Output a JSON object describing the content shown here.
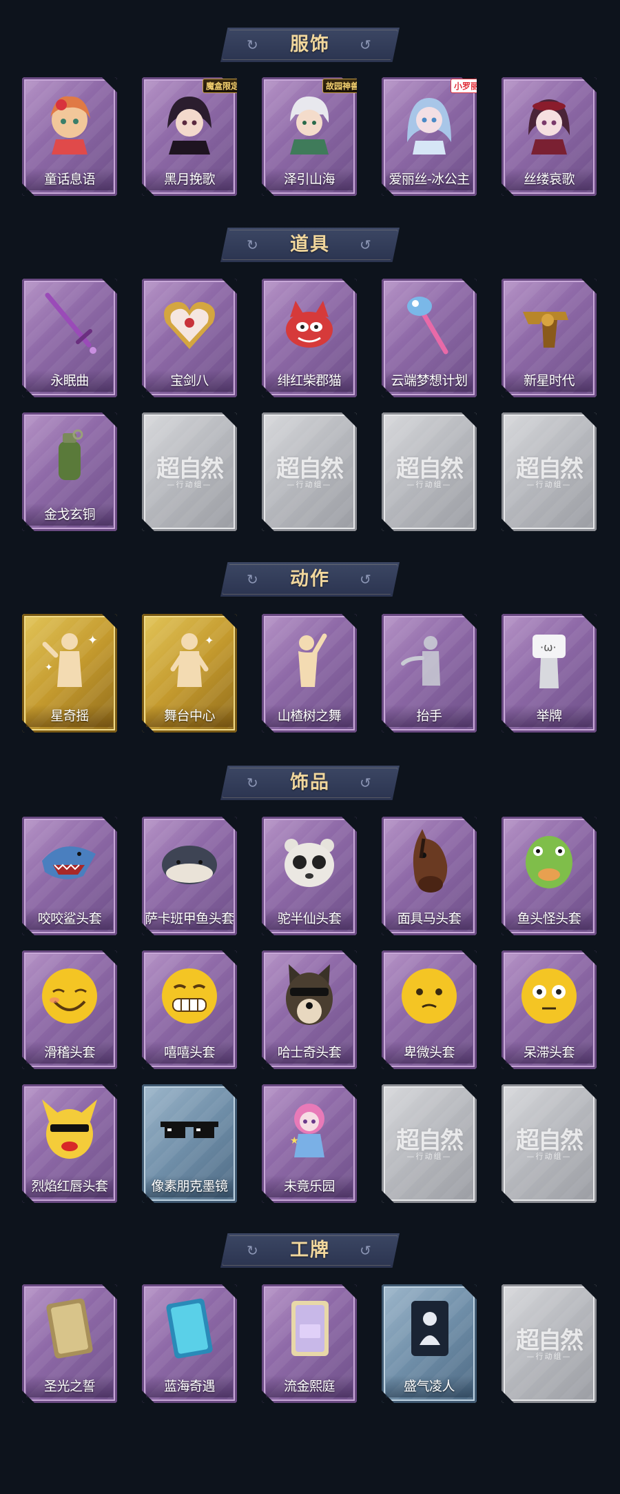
{
  "sections": [
    {
      "title": "服饰",
      "items": [
        {
          "label": "童话息语",
          "frame": "purple",
          "icon": "fairy-girl-costume"
        },
        {
          "label": "黑月挽歌",
          "frame": "purple",
          "icon": "dark-moon-girl-costume",
          "tag": "魔盒限定",
          "tag_style": "gold"
        },
        {
          "label": "泽引山海",
          "frame": "purple",
          "icon": "mountain-sea-boy-costume",
          "tag": "故园神兽",
          "tag_style": "gold"
        },
        {
          "label": "爱丽丝-冰公主",
          "frame": "purple",
          "icon": "ice-princess-costume",
          "tag": "小罗丽",
          "tag_style": "red"
        },
        {
          "label": "丝缕哀歌",
          "frame": "purple",
          "icon": "silk-elegy-girl-costume"
        }
      ]
    },
    {
      "title": "道具",
      "items": [
        {
          "label": "永眠曲",
          "frame": "purple",
          "icon": "sword-icon"
        },
        {
          "label": "宝剑八",
          "frame": "purple",
          "icon": "heart-mirror-icon"
        },
        {
          "label": "绯红柴郡猫",
          "frame": "purple",
          "icon": "red-cat-icon"
        },
        {
          "label": "云端梦想计划",
          "frame": "purple",
          "icon": "dream-wand-icon"
        },
        {
          "label": "新星时代",
          "frame": "purple",
          "icon": "revolver-icon"
        },
        {
          "label": "金戈玄铜",
          "frame": "purple",
          "icon": "grenade-icon"
        },
        {
          "label": "",
          "frame": "gray",
          "placeholder": true
        },
        {
          "label": "",
          "frame": "gray",
          "placeholder": true
        },
        {
          "label": "",
          "frame": "gray",
          "placeholder": true
        },
        {
          "label": "",
          "frame": "gray",
          "placeholder": true
        }
      ]
    },
    {
      "title": "动作",
      "items": [
        {
          "label": "星奇摇",
          "frame": "gold",
          "icon": "sparkle-dance-icon"
        },
        {
          "label": "舞台中心",
          "frame": "gold",
          "icon": "stage-center-icon"
        },
        {
          "label": "山楂树之舞",
          "frame": "purple",
          "icon": "hawthorn-dance-icon"
        },
        {
          "label": "抬手",
          "frame": "purple",
          "icon": "raise-hand-icon"
        },
        {
          "label": "举牌",
          "frame": "purple",
          "icon": "hold-sign-icon"
        }
      ]
    },
    {
      "title": "饰品",
      "items": [
        {
          "label": "咬咬鲨头套",
          "frame": "purple",
          "icon": "shark-head-icon"
        },
        {
          "label": "萨卡班甲鱼头套",
          "frame": "purple",
          "icon": "fish-head-icon"
        },
        {
          "label": "驼半仙头套",
          "frame": "purple",
          "icon": "bear-sunglasses-icon"
        },
        {
          "label": "面具马头套",
          "frame": "purple",
          "icon": "horse-mask-icon"
        },
        {
          "label": "鱼头怪头套",
          "frame": "purple",
          "icon": "green-fish-icon"
        },
        {
          "label": "滑稽头套",
          "frame": "purple",
          "icon": "smile-emoji-icon"
        },
        {
          "label": "嘻嘻头套",
          "frame": "purple",
          "icon": "grin-emoji-icon"
        },
        {
          "label": "哈士奇头套",
          "frame": "purple",
          "icon": "husky-icon"
        },
        {
          "label": "卑微头套",
          "frame": "purple",
          "icon": "pleading-emoji-icon"
        },
        {
          "label": "呆滞头套",
          "frame": "purple",
          "icon": "flushed-emoji-icon"
        },
        {
          "label": "烈焰红唇头套",
          "frame": "purple",
          "icon": "pikachu-lips-icon"
        },
        {
          "label": "像素朋克墨镜",
          "frame": "blue",
          "icon": "pixel-glasses-icon"
        },
        {
          "label": "未竟乐园",
          "frame": "purple",
          "icon": "doll-girl-icon"
        },
        {
          "label": "",
          "frame": "gray",
          "placeholder": true
        },
        {
          "label": "",
          "frame": "gray",
          "placeholder": true
        }
      ]
    },
    {
      "title": "工牌",
      "items": [
        {
          "label": "圣光之誓",
          "frame": "purple",
          "icon": "holy-light-card-icon"
        },
        {
          "label": "蓝海奇遇",
          "frame": "purple",
          "icon": "blue-sea-card-icon"
        },
        {
          "label": "流金熙庭",
          "frame": "purple",
          "icon": "golden-court-card-icon"
        },
        {
          "label": "盛气凌人",
          "frame": "blue",
          "icon": "silhouette-card-icon"
        },
        {
          "label": "",
          "frame": "gray",
          "placeholder": true
        }
      ]
    }
  ],
  "placeholder_text": {
    "main": "超自然",
    "sub": "—行动组—"
  },
  "colors": {
    "background": "#0d131c",
    "title_gold": "#f1d79d",
    "ribbon": "#2b3450",
    "purple_frame": "#8f6aa8",
    "gold_frame": "#c49a2e",
    "blue_frame": "#6f8ea8",
    "gray_frame": "#b5b7bc"
  }
}
